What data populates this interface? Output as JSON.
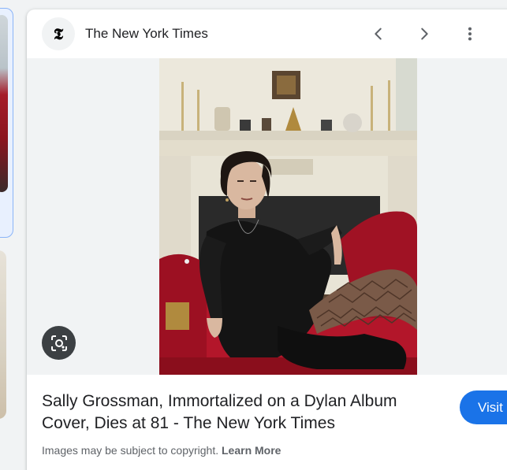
{
  "source": {
    "favicon_glyph": "𝕿",
    "name": "The New York Times"
  },
  "header_icons": {
    "prev": "chevron-left-icon",
    "next": "chevron-right-icon",
    "more": "more-vert-icon"
  },
  "image": {
    "lens_icon": "google-lens-icon"
  },
  "result": {
    "title": "Sally Grossman, Immortalized on a Dylan Album Cover, Dies at 81 - The New York Times",
    "visit_label": "Visit",
    "copyright_text": "Images may be subject to copyright.",
    "learn_more_label": "Learn More"
  },
  "colors": {
    "accent": "#1a73e8",
    "sofa_red": "#b3162a"
  }
}
